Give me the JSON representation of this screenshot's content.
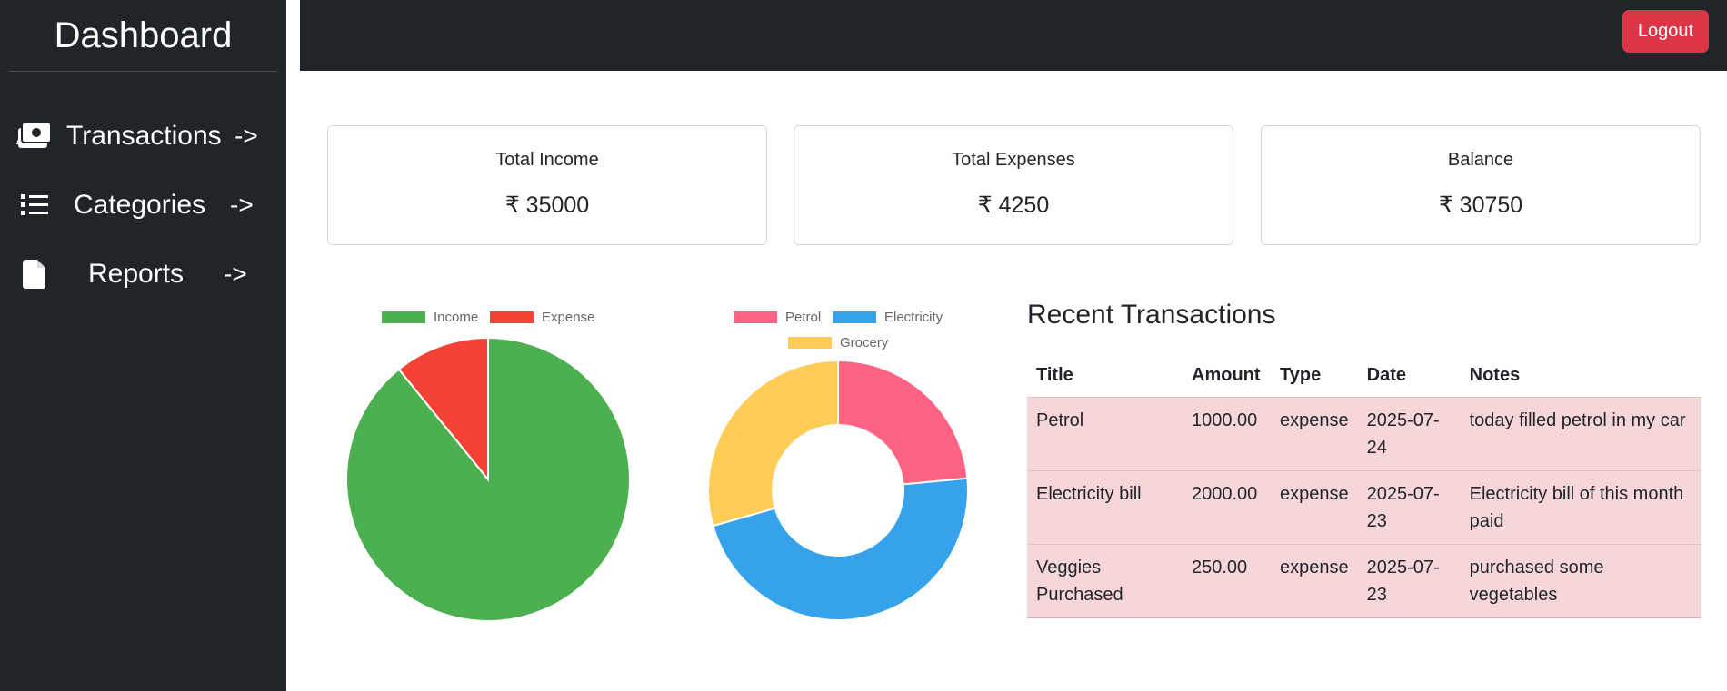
{
  "sidebar": {
    "brand": "Dashboard",
    "items": [
      {
        "label": "Transactions",
        "arrow": "->",
        "icon": "money-bill-icon"
      },
      {
        "label": "Categories",
        "arrow": "->",
        "icon": "list-icon"
      },
      {
        "label": "Reports",
        "arrow": "->",
        "icon": "file-icon"
      }
    ]
  },
  "topbar": {
    "logout_label": "Logout"
  },
  "cards": [
    {
      "title": "Total Income",
      "value": "₹ 35000"
    },
    {
      "title": "Total Expenses",
      "value": "₹ 4250"
    },
    {
      "title": "Balance",
      "value": "₹ 30750"
    }
  ],
  "chart_data": [
    {
      "type": "pie",
      "categories": [
        "Income",
        "Expense"
      ],
      "values": [
        35000,
        4250
      ],
      "colors": [
        "#4caf50",
        "#f44336"
      ],
      "legend": "top"
    },
    {
      "type": "pie",
      "style": "doughnut",
      "categories": [
        "Petrol",
        "Electricity",
        "Grocery"
      ],
      "values": [
        1000,
        2000,
        1250
      ],
      "colors": [
        "#ff6384",
        "#36a2eb",
        "#ffcd56"
      ],
      "legend": "top"
    }
  ],
  "recent": {
    "title": "Recent Transactions",
    "columns": [
      "Title",
      "Amount",
      "Type",
      "Date",
      "Notes"
    ],
    "rows": [
      [
        "Petrol",
        "1000.00",
        "expense",
        "2025-07-24",
        "today filled petrol in my car"
      ],
      [
        "Electricity bill",
        "2000.00",
        "expense",
        "2025-07-23",
        "Electricity bill of this month paid"
      ],
      [
        "Veggies Purchased",
        "250.00",
        "expense",
        "2025-07-23",
        "purchased some vegetables"
      ]
    ]
  }
}
